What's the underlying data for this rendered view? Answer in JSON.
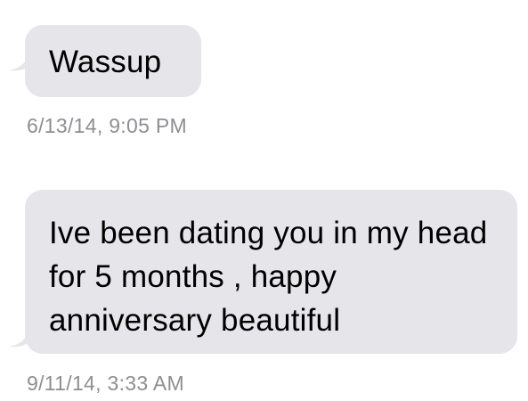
{
  "colors": {
    "bubble_background": "#e5e5ea",
    "message_text": "#000000",
    "timestamp_text": "#8e8e93",
    "background": "#ffffff"
  },
  "messages": [
    {
      "direction": "incoming",
      "text": "Wassup",
      "timestamp": "6/13/14, 9:05 PM"
    },
    {
      "direction": "incoming",
      "text": "Ive been dating you in my head for 5 months , happy anniversary beautiful",
      "timestamp": "9/11/14, 3:33 AM"
    }
  ]
}
